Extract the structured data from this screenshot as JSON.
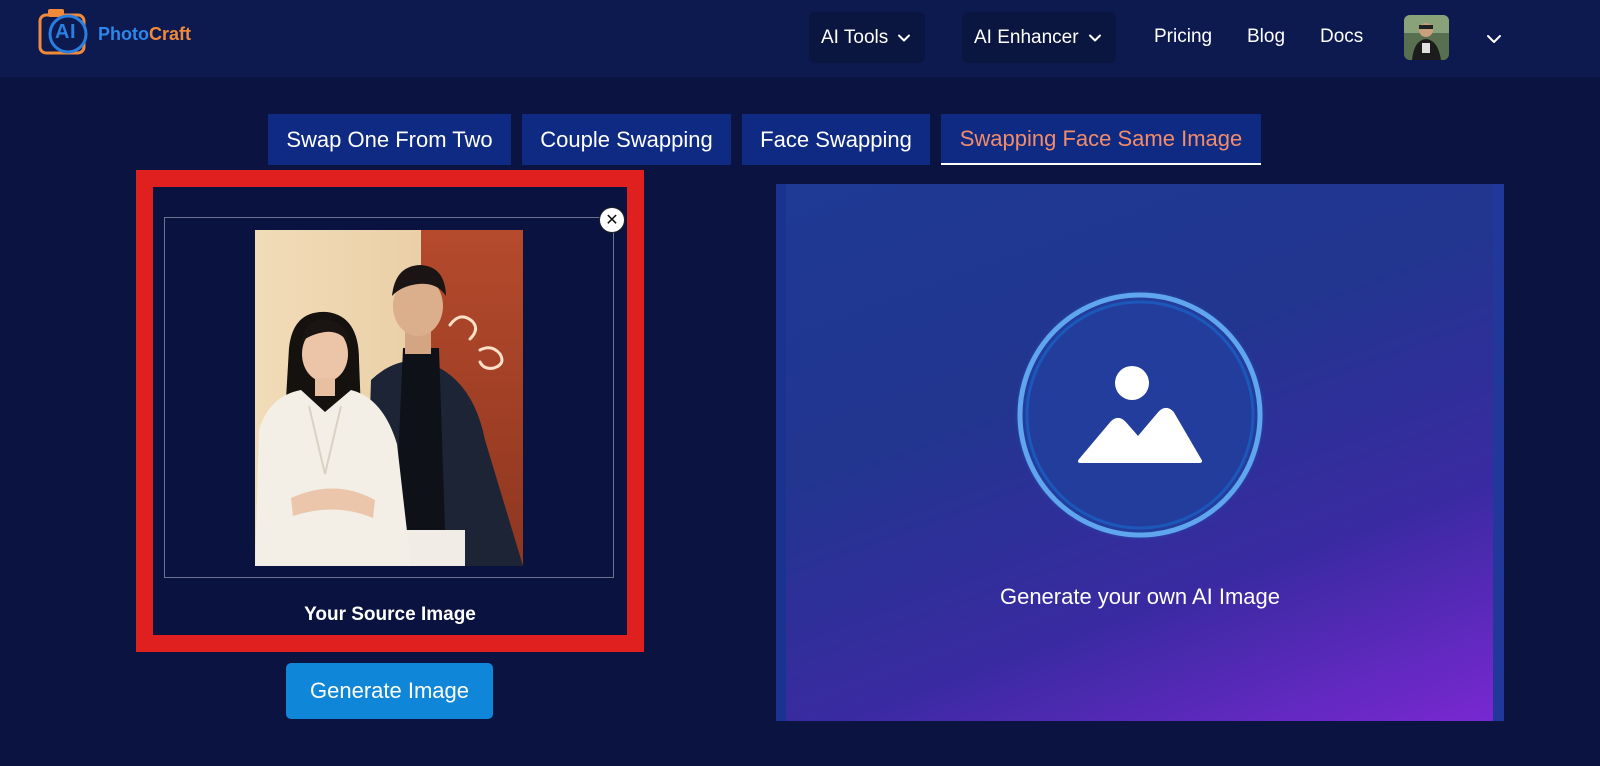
{
  "brand": {
    "logo_ai": "AI",
    "logo_photo": "Photo",
    "logo_craft": "Craft"
  },
  "nav": {
    "ai_tools": "AI Tools",
    "ai_enhancer": "AI Enhancer",
    "pricing": "Pricing",
    "blog": "Blog",
    "docs": "Docs"
  },
  "tabs": [
    {
      "label": "Swap One From Two",
      "active": false
    },
    {
      "label": "Couple Swapping",
      "active": false
    },
    {
      "label": "Face Swapping",
      "active": false
    },
    {
      "label": "Swapping Face Same Image",
      "active": true
    }
  ],
  "source": {
    "label": "Your Source Image",
    "close_symbol": "✕"
  },
  "actions": {
    "generate_label": "Generate Image"
  },
  "result": {
    "placeholder_text": "Generate your own AI Image"
  },
  "colors": {
    "background": "#0b1340",
    "header": "#0d1a4f",
    "tab": "#0f2a82",
    "active_tab_text": "#f28c6a",
    "highlight_frame": "#e0201f",
    "generate_button": "#0f86d8",
    "result_gradient_start": "#1e3a94",
    "result_gradient_end": "#7a28d2"
  },
  "icons": [
    "camera-logo-icon",
    "chevron-down-icon",
    "close-icon",
    "image-placeholder-icon",
    "user-avatar"
  ]
}
